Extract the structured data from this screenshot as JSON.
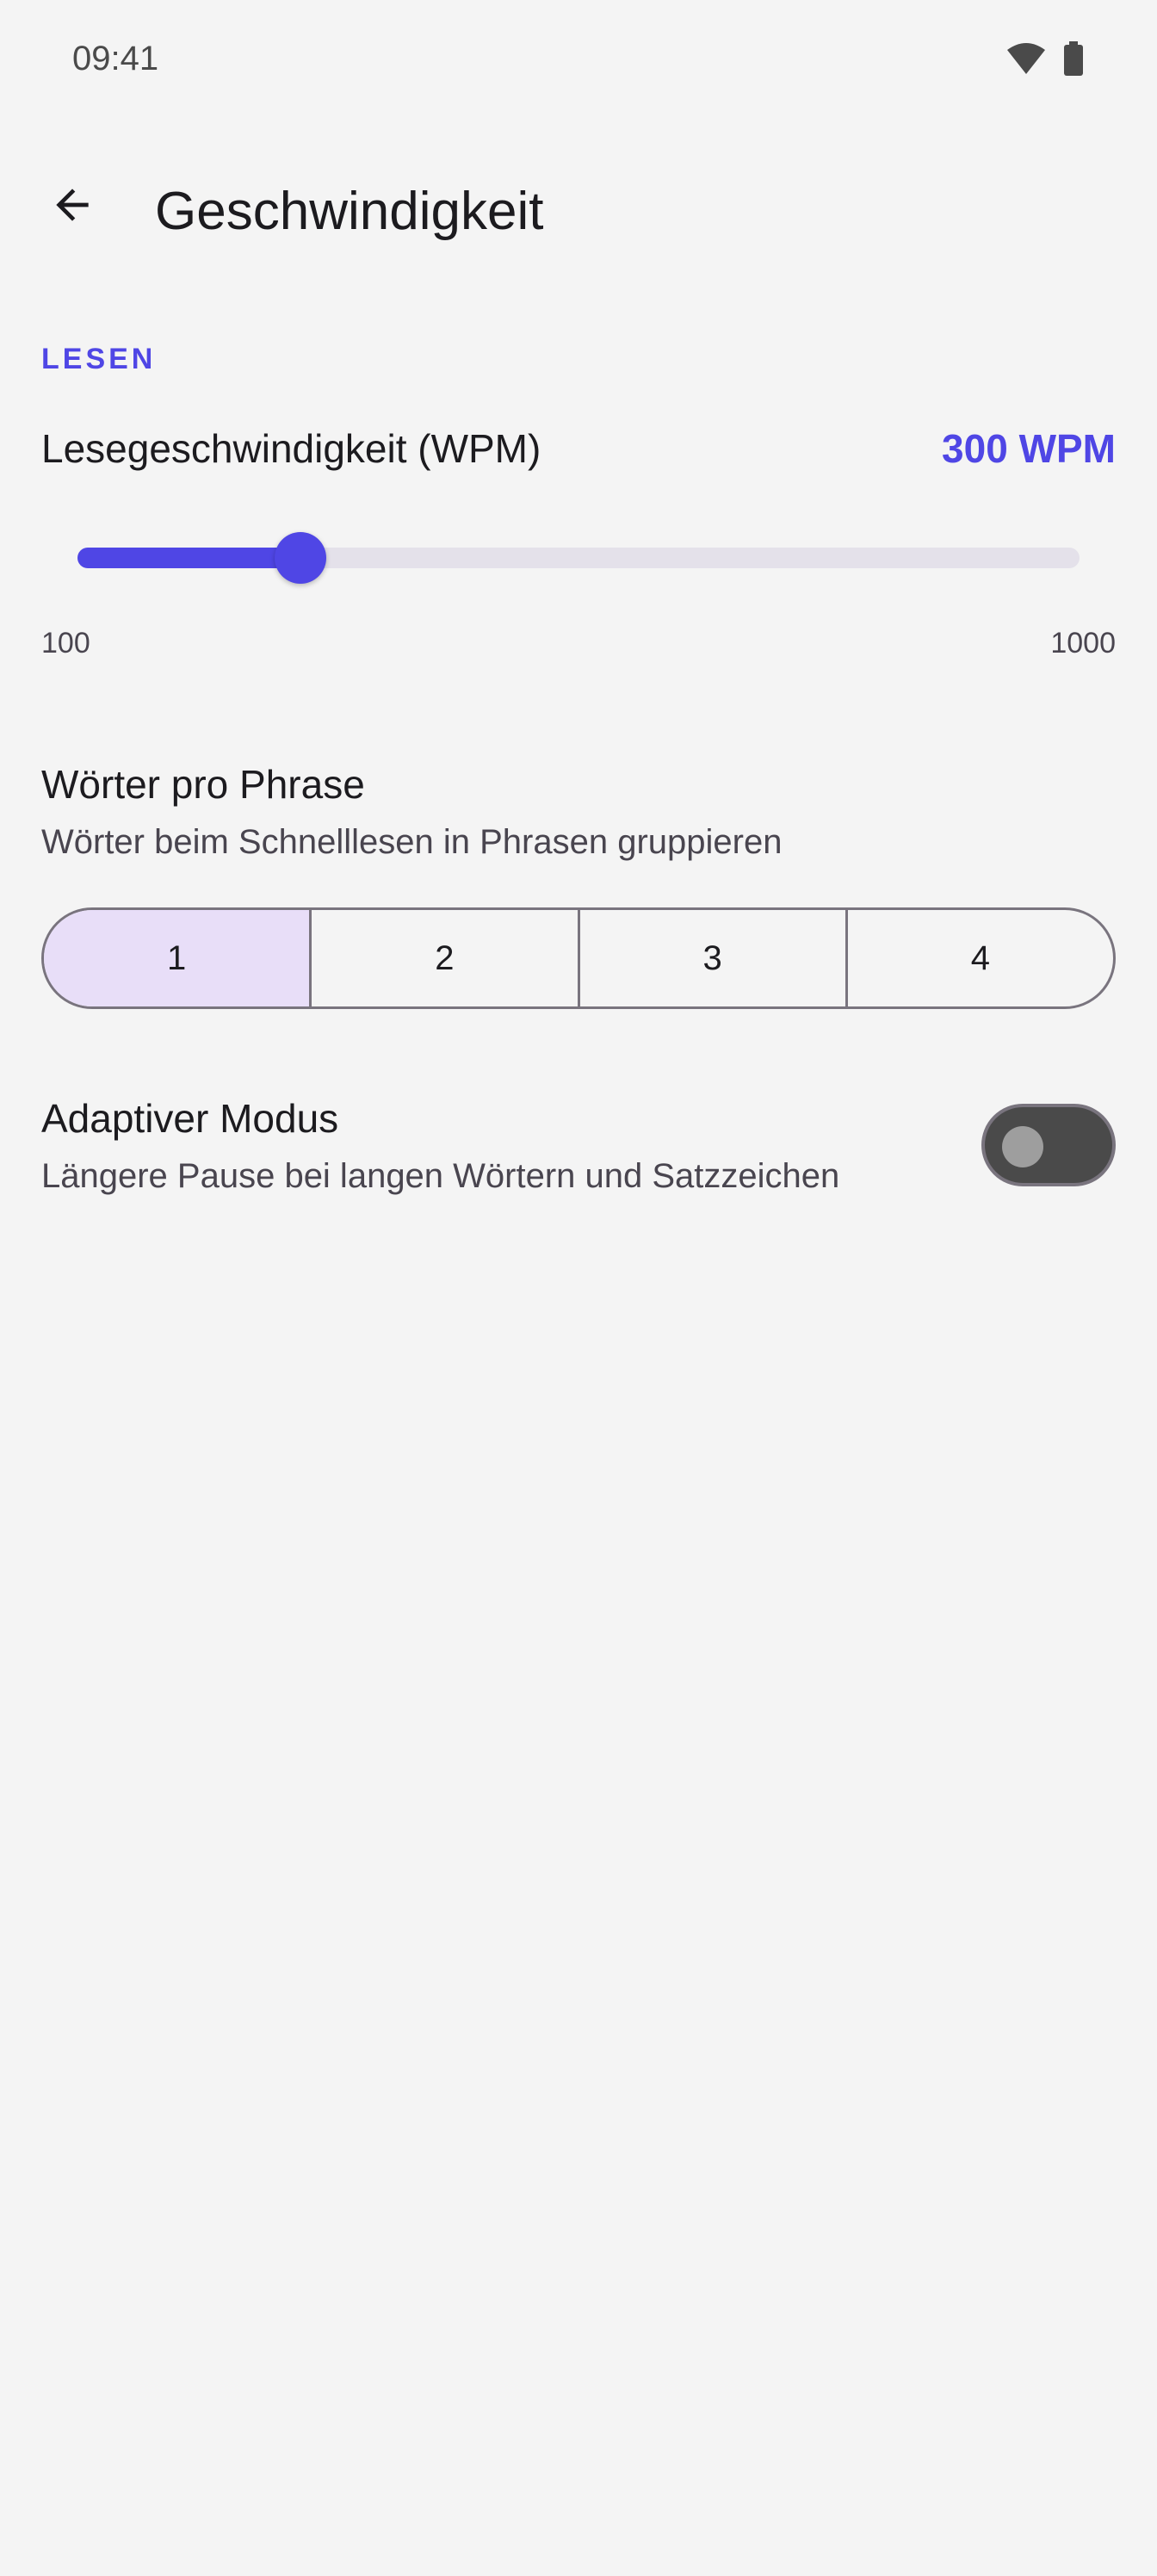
{
  "status_bar": {
    "time": "09:41",
    "icons": [
      "wifi-icon",
      "battery-icon"
    ]
  },
  "app_bar": {
    "back_icon": "arrow-back-icon",
    "title": "Geschwindigkeit"
  },
  "section": {
    "header": "LESEN"
  },
  "reading_speed": {
    "label": "Lesegeschwindigkeit (WPM)",
    "value_text": "300 WPM",
    "value": 300,
    "min": 100,
    "max": 1000,
    "min_label": "100",
    "max_label": "1000"
  },
  "words_per_phrase": {
    "title": "Wörter pro Phrase",
    "subtitle": "Wörter beim Schnelllesen in Phrasen gruppieren",
    "options": [
      "1",
      "2",
      "3",
      "4"
    ],
    "selected": "1"
  },
  "adaptive_mode": {
    "title": "Adaptiver Modus",
    "subtitle": "Längere Pause bei langen Wörtern und Satzzeichen",
    "enabled": false
  },
  "colors": {
    "accent": "#4F46E5",
    "background": "#F4F4F4",
    "segment_selected": "#E8DEF8",
    "switch_off_track": "#4A4A4A"
  }
}
